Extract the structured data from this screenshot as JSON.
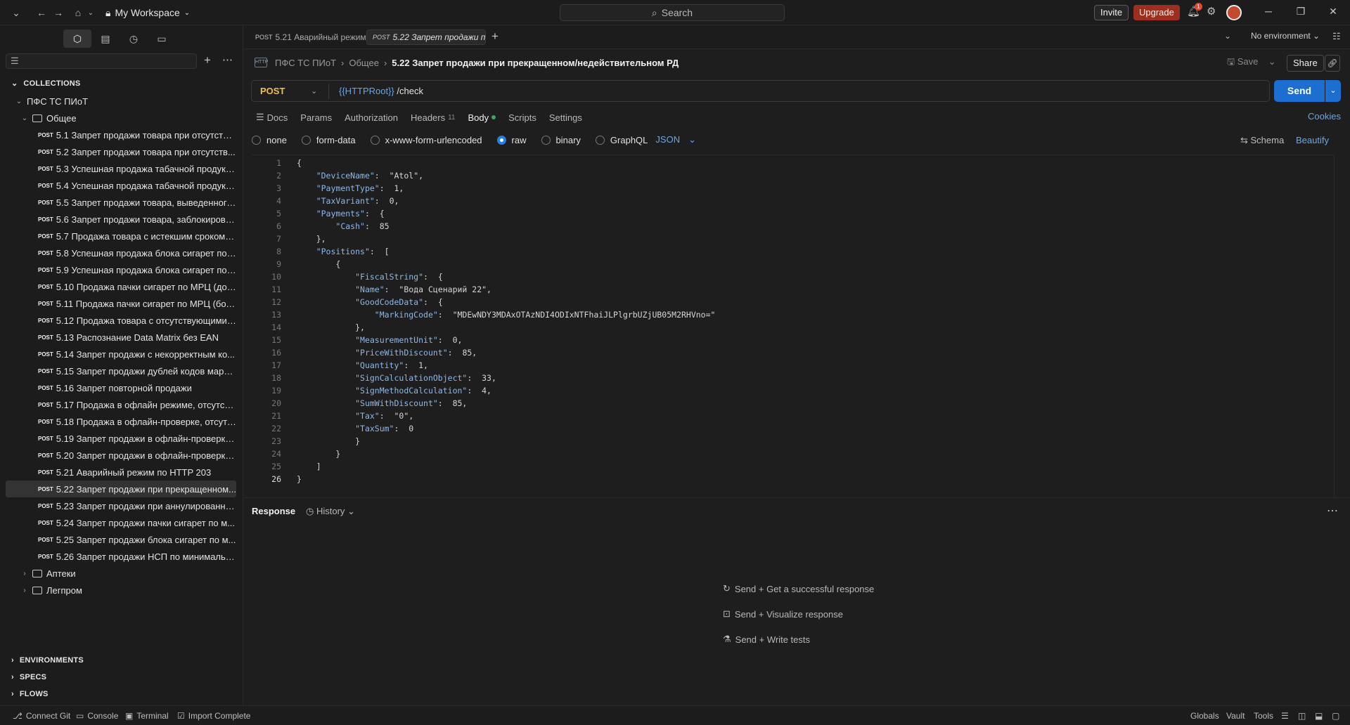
{
  "workspace": {
    "name": "My Workspace"
  },
  "search": {
    "placeholder": "Search"
  },
  "header": {
    "invite": "Invite",
    "upgrade": "Upgrade",
    "notif_count": "1"
  },
  "sidebar": {
    "collections_label": "COLLECTIONS",
    "collection_name": "ПФС ТС ПИоТ",
    "folder_open": "Общее",
    "method": "POST",
    "requests": [
      "5.1 Запрет продажи товара при отсутстви...",
      "5.2 Запрет продажи товара при отсутств...",
      "5.3 Успешная продажа табачной продукц...",
      "5.4 Успешная продажа табачной продукц...",
      "5.5 Запрет продажи товара, выведенного...",
      "5.6 Запрет продажи товара, заблокирова...",
      "5.7 Продажа товара с истекшим сроком г...",
      "5.8 Успешная продажа блока сигарет по ...",
      "5.9 Успешная продажа блока сигарет по ...",
      "5.10 Продажа пачки сигарет по МРЦ (до 1...",
      "5.11 Продажа пачки сигарет по МРЦ (бол...",
      "5.12 Продажа товара с отсутствующими ...",
      "5.13 Распознание Data Matrix без EAN",
      "5.14 Запрет продажи с некорректным ко...",
      "5.15 Запрет продажи дублей кодов марки...",
      "5.16 Запрет повторной продажи",
      "5.17 Продажа в офлайн режиме, отсутств...",
      "5.18 Продажа в офлайн-проверке, отсутс...",
      "5.19 Запрет продажи в офлайн-проверке,...",
      "5.20 Запрет продажи в офлайн-проверке ...",
      "5.21 Аварийный режим по HTTP 203",
      "5.22 Запрет продажи при прекращенном...",
      "5.23 Запрет продажи при аннулированно...",
      "5.24 Запрет продажи пачки сигарет по м...",
      "5.25 Запрет продажи блока сигарет по м...",
      "5.26 Запрет продажи НСП по минимальн..."
    ],
    "selected_index": 21,
    "folders_closed": [
      "Аптеки",
      "Легпром"
    ],
    "bottom_sections": [
      "ENVIRONMENTS",
      "SPECS",
      "FLOWS"
    ]
  },
  "tabs": [
    {
      "method": "POST",
      "label": "5.21 Аварийный режим"
    },
    {
      "method": "POST",
      "label": "5.22 Запрет продажи п"
    }
  ],
  "environment": "No environment",
  "breadcrumb": {
    "collection": "ПФС ТС ПИоТ",
    "folder": "Общее",
    "current": "5.22 Запрет продажи при прекращенном/недействительном РД"
  },
  "actions": {
    "save": "Save",
    "share": "Share"
  },
  "request": {
    "method": "POST",
    "url_var": "{{HTTPRoot}}",
    "url_path": " /check",
    "send": "Send"
  },
  "request_tabs": [
    {
      "label": "Docs"
    },
    {
      "label": "Params"
    },
    {
      "label": "Authorization"
    },
    {
      "label": "Headers",
      "count": "11"
    },
    {
      "label": "Body"
    },
    {
      "label": "Scripts"
    },
    {
      "label": "Settings"
    }
  ],
  "cookies": "Cookies",
  "body_types": [
    "none",
    "form-data",
    "x-www-form-urlencoded",
    "raw",
    "binary",
    "GraphQL"
  ],
  "body_type_selected": "raw",
  "body_format": "JSON",
  "schema": "Schema",
  "beautify": "Beautify",
  "code_lines": [
    "{",
    "    \"DeviceName\":  \"Atol\",",
    "    \"PaymentType\":  1,",
    "    \"TaxVariant\":  0,",
    "    \"Payments\":  {",
    "        \"Cash\":  85",
    "    },",
    "    \"Positions\":  [",
    "        {",
    "            \"FiscalString\":  {",
    "            \"Name\":  \"Вода Сценарий 22\",",
    "            \"GoodCodeData\":  {",
    "                \"MarkingCode\":  \"MDEwNDY3MDAxOTAzNDI4ODIxNTFhaiJLPlgrbUZjUB05M2RHVno=\"",
    "            },",
    "            \"MeasurementUnit\":  0,",
    "            \"PriceWithDiscount\":  85,",
    "            \"Quantity\":  1,",
    "            \"SignCalculationObject\":  33,",
    "            \"SignMethodCalculation\":  4,",
    "            \"SumWithDiscount\":  85,",
    "            \"Tax\":  \"0\",",
    "            \"TaxSum\":  0",
    "            }",
    "        }",
    "    ]",
    "}"
  ],
  "response": {
    "title": "Response",
    "history": "History",
    "hints": [
      "Send + Get a successful response",
      "Send + Visualize response",
      "Send + Write tests"
    ]
  },
  "statusbar": {
    "left": [
      "Connect Git",
      "Console",
      "Terminal",
      "Import Complete"
    ],
    "right": [
      "Globals",
      "Vault",
      "Tools"
    ]
  }
}
